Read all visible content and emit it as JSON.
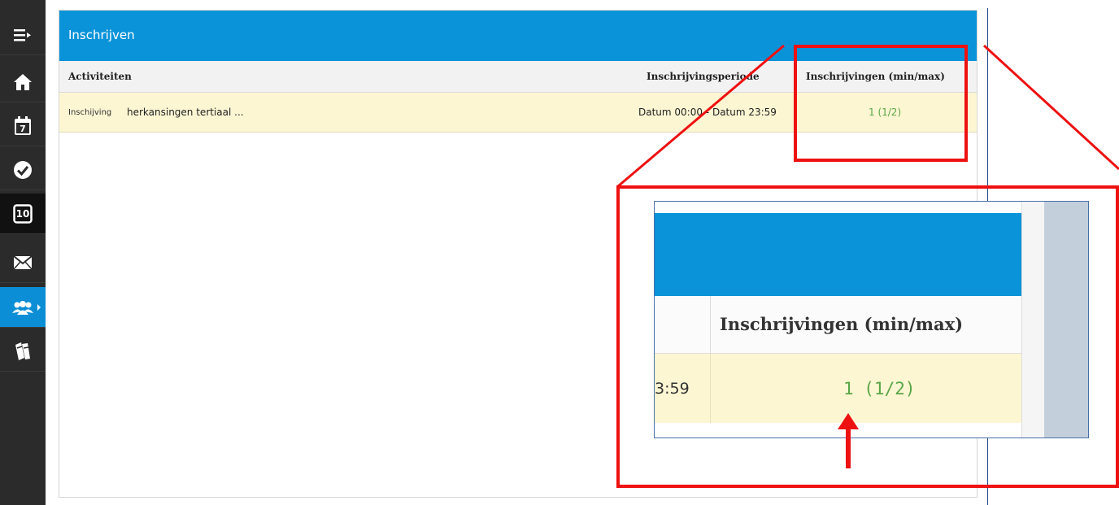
{
  "panel": {
    "title": "Inschrijven",
    "columns": {
      "activities": "Activiteiten",
      "period": "Inschrijvingsperiode",
      "registrations": "Inschrijvingen (min/max)"
    },
    "rows": [
      {
        "type_label": "Inschijving",
        "name": "herkansingen tertiaal ...",
        "period": "Datum 00:00 - Datum 23:59",
        "count": "1 (1/2)"
      }
    ]
  },
  "sidebar": {
    "items": [
      {
        "icon": "menu-icon"
      },
      {
        "icon": "home-icon"
      },
      {
        "icon": "calendar-icon",
        "label": "7"
      },
      {
        "icon": "check-circle-icon"
      },
      {
        "icon": "grade-icon",
        "label": "10"
      },
      {
        "icon": "mail-icon"
      },
      {
        "icon": "users-icon",
        "active": true
      },
      {
        "icon": "books-icon"
      }
    ]
  },
  "zoom": {
    "column_header": "Inschrijvingen (min/max)",
    "time_fragment": "3:59",
    "count": "1 (1/2)"
  },
  "colors": {
    "header_blue": "#0a93d8",
    "sidebar_dark": "#2b2b2b",
    "row_highlight": "#fdf6d3",
    "count_green": "#5aa646",
    "annotation_red": "#ee1111"
  }
}
